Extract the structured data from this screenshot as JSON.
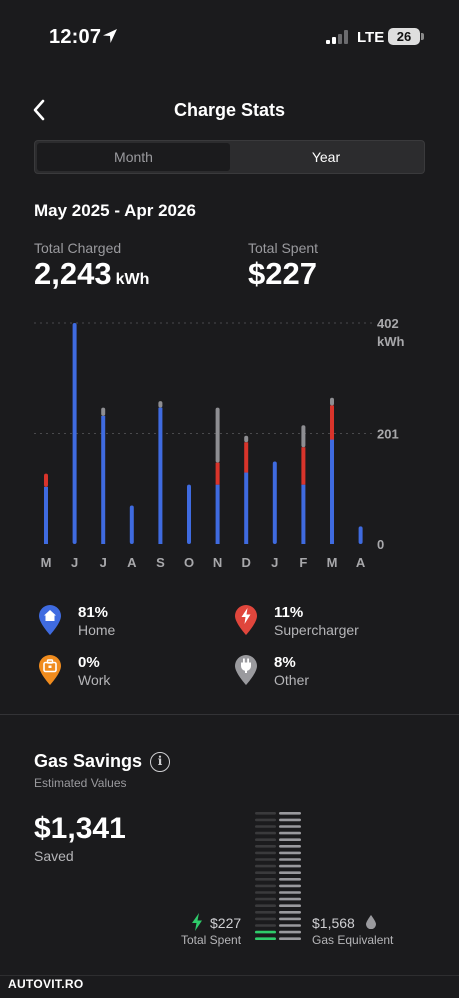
{
  "status_bar": {
    "time": "12:07",
    "network": "LTE",
    "battery": "26"
  },
  "header": {
    "title": "Charge Stats"
  },
  "segmented": {
    "month": "Month",
    "year": "Year",
    "selected": "Year"
  },
  "summary": {
    "date_range": "May 2025 - Apr 2026",
    "total_charged_label": "Total Charged",
    "total_charged_value": "2,243",
    "total_charged_unit": "kWh",
    "total_spent_label": "Total Spent",
    "total_spent_value": "$227"
  },
  "chart_data": {
    "type": "bar",
    "stacked": true,
    "categories": [
      "M",
      "J",
      "J",
      "A",
      "S",
      "O",
      "N",
      "D",
      "J",
      "F",
      "M",
      "A"
    ],
    "y_ticks": [
      {
        "value": 402,
        "label": "402"
      },
      {
        "value": 201,
        "label": "201"
      },
      {
        "value": 0,
        "label": "0"
      }
    ],
    "y_unit": "kWh",
    "ylim": [
      0,
      402
    ],
    "colors": {
      "Home": "#3f6be0",
      "Supercharger": "#d9342b",
      "Other": "#8e8e92"
    },
    "series": [
      {
        "name": "Home",
        "values": [
          104,
          402,
          233,
          70,
          248,
          108,
          108,
          130,
          150,
          108,
          190,
          32
        ]
      },
      {
        "name": "Supercharger",
        "values": [
          24,
          0,
          0,
          0,
          0,
          0,
          40,
          55,
          0,
          68,
          62,
          0
        ]
      },
      {
        "name": "Other",
        "values": [
          0,
          0,
          15,
          0,
          12,
          0,
          100,
          12,
          0,
          40,
          14,
          0
        ]
      }
    ],
    "gridlines": "dotted"
  },
  "legend": [
    {
      "pct": "81%",
      "name": "Home",
      "color": "#3f6be0",
      "icon": "home-icon"
    },
    {
      "pct": "11%",
      "name": "Supercharger",
      "color": "#e0463c",
      "icon": "bolt-icon"
    },
    {
      "pct": "0%",
      "name": "Work",
      "color": "#f08c1e",
      "icon": "briefcase-icon"
    },
    {
      "pct": "8%",
      "name": "Other",
      "color": "#9a9a9e",
      "icon": "plug-icon"
    }
  ],
  "gas_savings": {
    "title": "Gas Savings",
    "subtitle": "Estimated Values",
    "saved_value": "$1,341",
    "saved_label": "Saved",
    "spent_value": "$227",
    "spent_label": "Total Spent",
    "gas_value": "$1,568",
    "gas_label": "Gas Equivalent",
    "spent_fraction": 0.145
  },
  "watermark": "AUTOVIT.RO"
}
